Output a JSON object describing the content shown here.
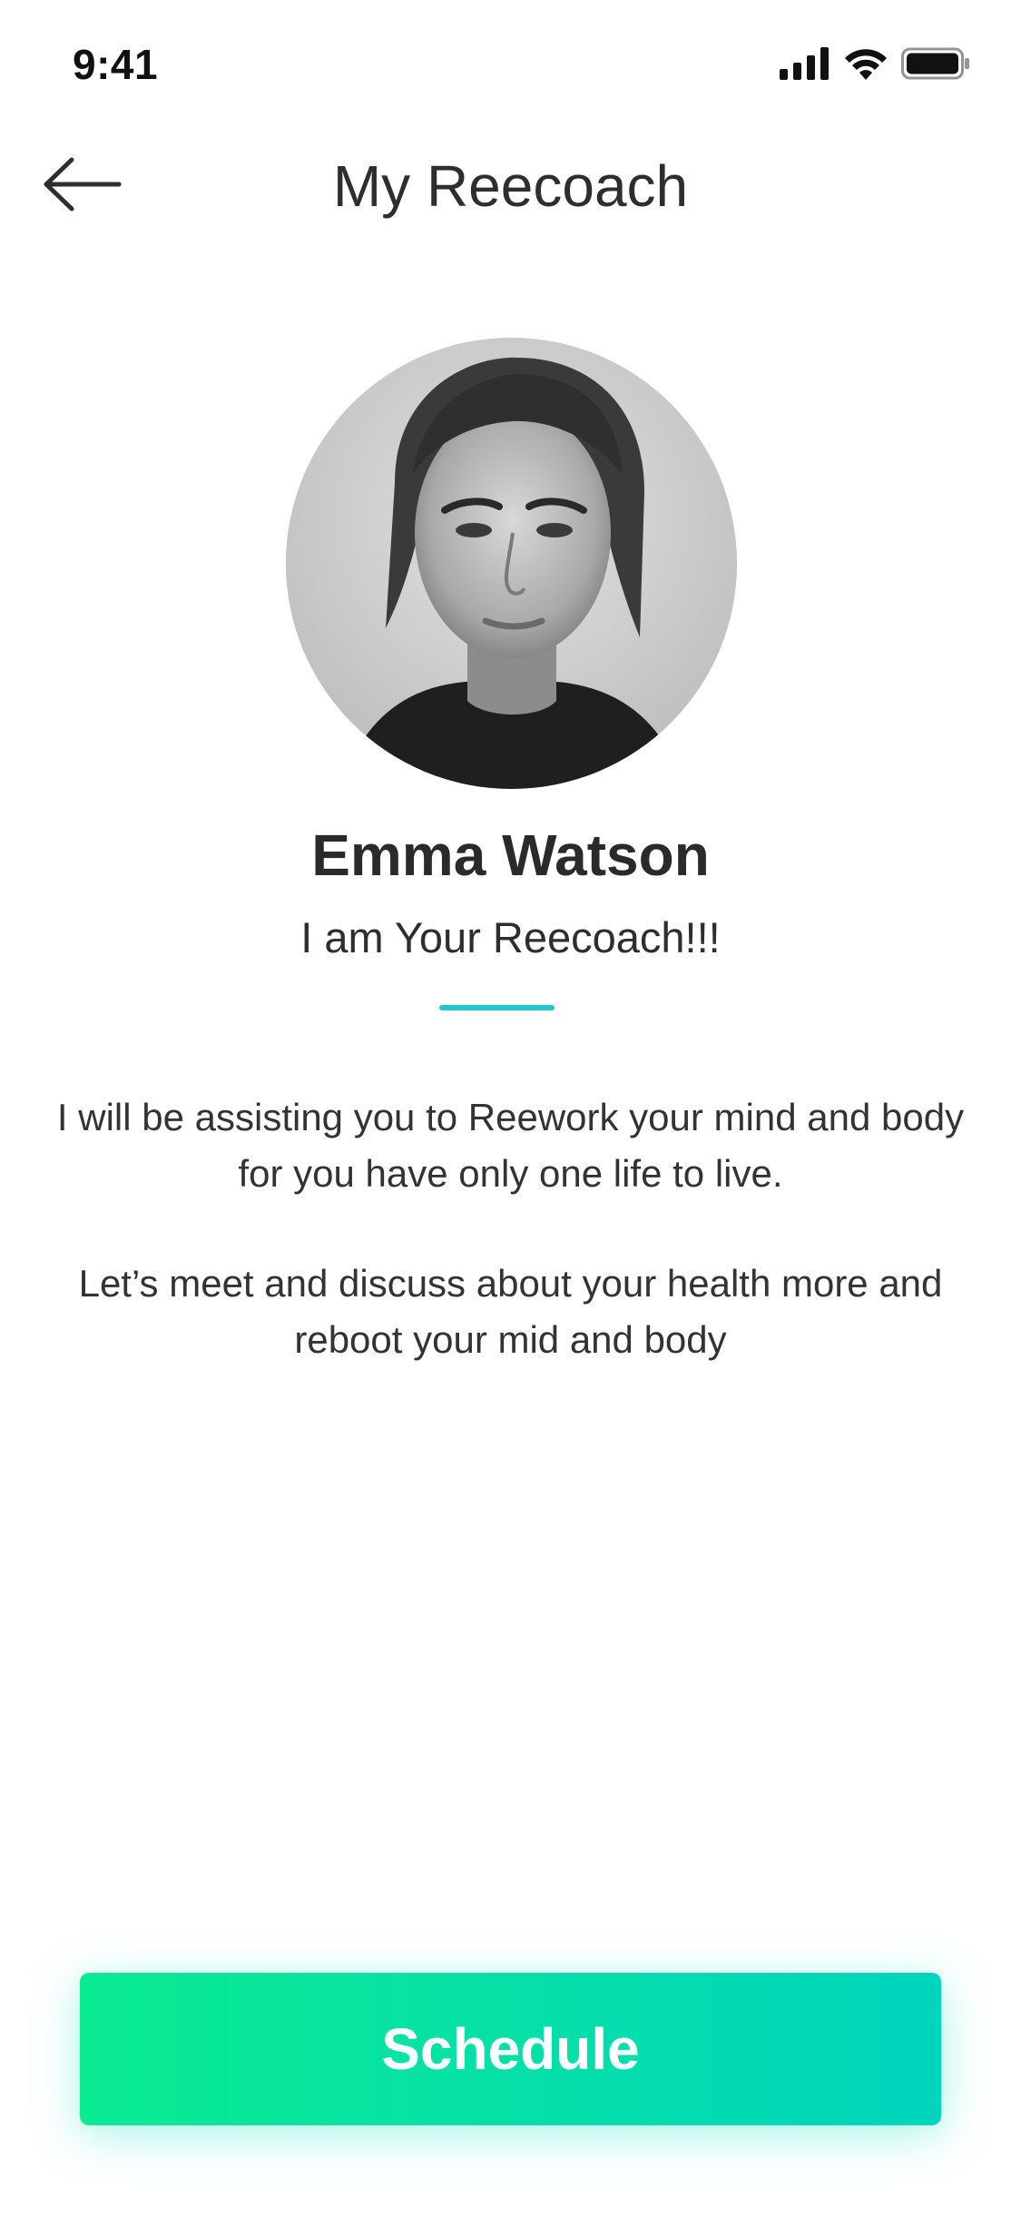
{
  "status_bar": {
    "time": "9:41",
    "icons": [
      "cellular-signal-icon",
      "wifi-icon",
      "battery-icon"
    ]
  },
  "nav": {
    "title": "My Reecoach",
    "back_icon": "arrow-left-icon"
  },
  "coach": {
    "name": "Emma Watson",
    "tagline": "I am Your Reecoach!!!",
    "accent_color": "#1ec8c8"
  },
  "description": {
    "paragraph_1": "I will be assisting you to Reework your mind and body for you have only one life to live.",
    "paragraph_2": "Let’s meet and discuss about your health more and reboot your mid and body"
  },
  "actions": {
    "schedule_label": "Schedule",
    "gradient_start": "#0aeb92",
    "gradient_end": "#00d5bd"
  }
}
